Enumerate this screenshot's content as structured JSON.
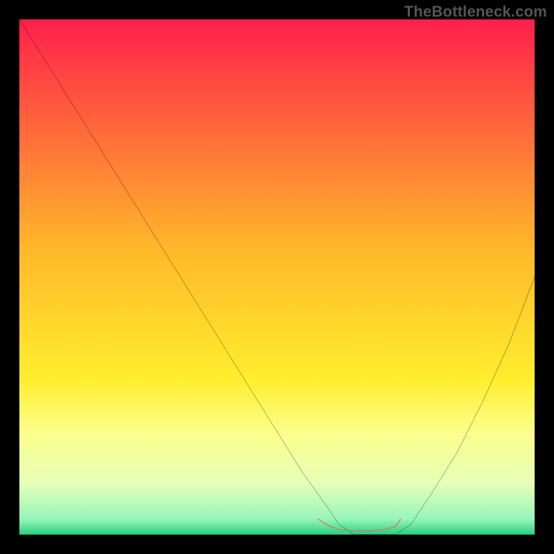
{
  "watermark": "TheBottleneck.com",
  "chart_data": {
    "type": "line",
    "title": "",
    "xlabel": "",
    "ylabel": "",
    "xlim": [
      0,
      100
    ],
    "ylim": [
      0,
      100
    ],
    "background_gradient": [
      {
        "offset": 0.0,
        "color": "#ff1f4b"
      },
      {
        "offset": 0.45,
        "color": "#ffb92a"
      },
      {
        "offset": 0.7,
        "color": "#ffee2e"
      },
      {
        "offset": 0.8,
        "color": "#fcff8a"
      },
      {
        "offset": 0.9,
        "color": "#e6ffb8"
      },
      {
        "offset": 0.97,
        "color": "#97f5ba"
      },
      {
        "offset": 1.0,
        "color": "#27d07c"
      }
    ],
    "series": [
      {
        "name": "bottleneck-curve",
        "color": "#000000",
        "x": [
          0,
          5,
          10,
          15,
          20,
          25,
          30,
          35,
          40,
          45,
          50,
          55,
          60,
          62,
          65,
          70,
          73,
          76,
          80,
          85,
          90,
          95,
          100
        ],
        "values": [
          100,
          92,
          84,
          76,
          68,
          60,
          52,
          44,
          36,
          28,
          20,
          12,
          5,
          2,
          0,
          0,
          0,
          2,
          8,
          16,
          26,
          37,
          50
        ]
      }
    ],
    "marker": {
      "name": "optimal-zone",
      "color": "#e36a63",
      "x": [
        58,
        60,
        62,
        65,
        68,
        71,
        73,
        74
      ],
      "values": [
        3,
        1.7,
        1.0,
        0.7,
        0.7,
        1.0,
        1.6,
        3
      ]
    }
  }
}
